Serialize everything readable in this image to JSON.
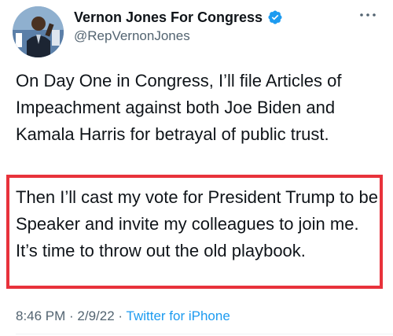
{
  "tweet": {
    "author": {
      "display_name": "Vernon Jones For Congress",
      "handle": "@RepVernonJones",
      "verified": true
    },
    "icons": {
      "verified": "verified-badge-icon",
      "more": "more-options-icon"
    },
    "paragraphs": [
      "On Day One in Congress, I’ll file Articles of Impeachment against both Joe Biden and Kamala Harris for betrayal of public trust.",
      "Then I’ll cast my vote for President Trump to be Speaker and invite my colleagues to join me. It’s time to throw out the old playbook."
    ],
    "meta": {
      "time": "8:46 PM",
      "separator": " · ",
      "date": "2/9/22",
      "source": "Twitter for iPhone"
    }
  },
  "colors": {
    "highlight_border": "#e8323b",
    "link": "#1d9bf0",
    "secondary_text": "#536471",
    "verified_badge": "#1d9bf0"
  }
}
